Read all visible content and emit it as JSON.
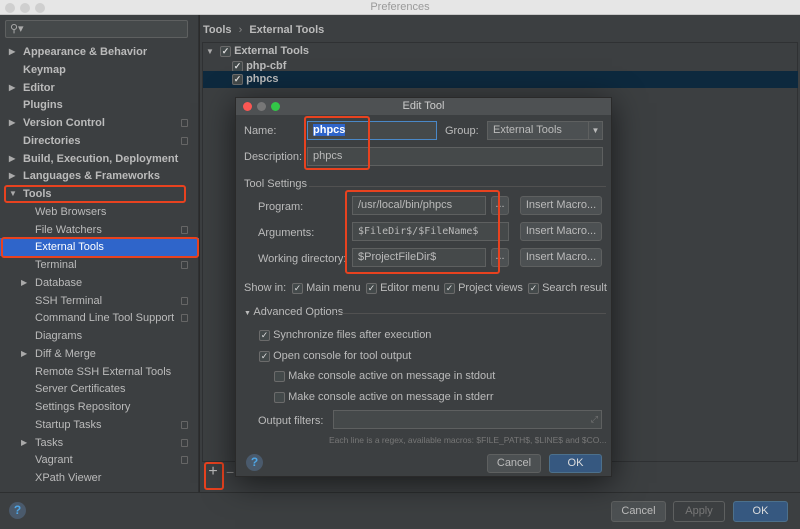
{
  "window": {
    "title": "Preferences"
  },
  "search": {
    "placeholder": ""
  },
  "sidebar": {
    "items": [
      {
        "label": "Appearance & Behavior",
        "arrow": "▶"
      },
      {
        "label": "Keymap"
      },
      {
        "label": "Editor",
        "arrow": "▶"
      },
      {
        "label": "Plugins"
      },
      {
        "label": "Version Control",
        "arrow": "▶"
      },
      {
        "label": "Directories"
      },
      {
        "label": "Build, Execution, Deployment",
        "arrow": "▶"
      },
      {
        "label": "Languages & Frameworks",
        "arrow": "▶"
      },
      {
        "label": "Tools",
        "arrow": "▼"
      },
      {
        "label": "Web Browsers"
      },
      {
        "label": "File Watchers"
      },
      {
        "label": "External Tools"
      },
      {
        "label": "Terminal"
      },
      {
        "label": "Database",
        "arrow": "▶"
      },
      {
        "label": "SSH Terminal"
      },
      {
        "label": "Command Line Tool Support"
      },
      {
        "label": "Diagrams"
      },
      {
        "label": "Diff & Merge",
        "arrow": "▶"
      },
      {
        "label": "Remote SSH External Tools"
      },
      {
        "label": "Server Certificates"
      },
      {
        "label": "Settings Repository"
      },
      {
        "label": "Startup Tasks"
      },
      {
        "label": "Tasks",
        "arrow": "▶"
      },
      {
        "label": "Vagrant"
      },
      {
        "label": "XPath Viewer"
      }
    ]
  },
  "breadcrumb": {
    "parent": "Tools",
    "sep": "›",
    "current": "External Tools"
  },
  "tree": {
    "group": "External Tools",
    "items": [
      "php-cbf",
      "phpcs"
    ]
  },
  "toolbar": {
    "add": "+",
    "remove": "−"
  },
  "dialog": {
    "title": "Edit Tool",
    "name_label": "Name:",
    "name_value": "phpcs",
    "group_label": "Group:",
    "group_value": "External Tools",
    "desc_label": "Description:",
    "desc_value": "phpcs",
    "tool_settings": "Tool Settings",
    "program_label": "Program:",
    "program_value": "/usr/local/bin/phpcs",
    "arguments_label": "Arguments:",
    "arguments_value": "$FileDir$/$FileName$",
    "workdir_label": "Working directory:",
    "workdir_value": "$ProjectFileDir$",
    "browse": "...",
    "insert_macro": "Insert Macro...",
    "show_in": "Show in:",
    "show_main": "Main menu",
    "show_editor": "Editor menu",
    "show_project": "Project views",
    "show_search": "Search result",
    "advanced": "Advanced Options",
    "sync": "Synchronize files after execution",
    "open_console": "Open console for tool output",
    "stdout": "Make console active on message in stdout",
    "stderr": "Make console active on message in stderr",
    "output_filters": "Output filters:",
    "hint": "Each line is a regex, available macros: $FILE_PATH$, $LINE$ and $CO...",
    "help": "?",
    "cancel": "Cancel",
    "ok": "OK"
  },
  "footer": {
    "help": "?",
    "cancel": "Cancel",
    "apply": "Apply",
    "ok": "OK"
  },
  "colors": {
    "selection": "#2f65ca",
    "highlight": "#e8421f",
    "primary_button": "#365880"
  }
}
